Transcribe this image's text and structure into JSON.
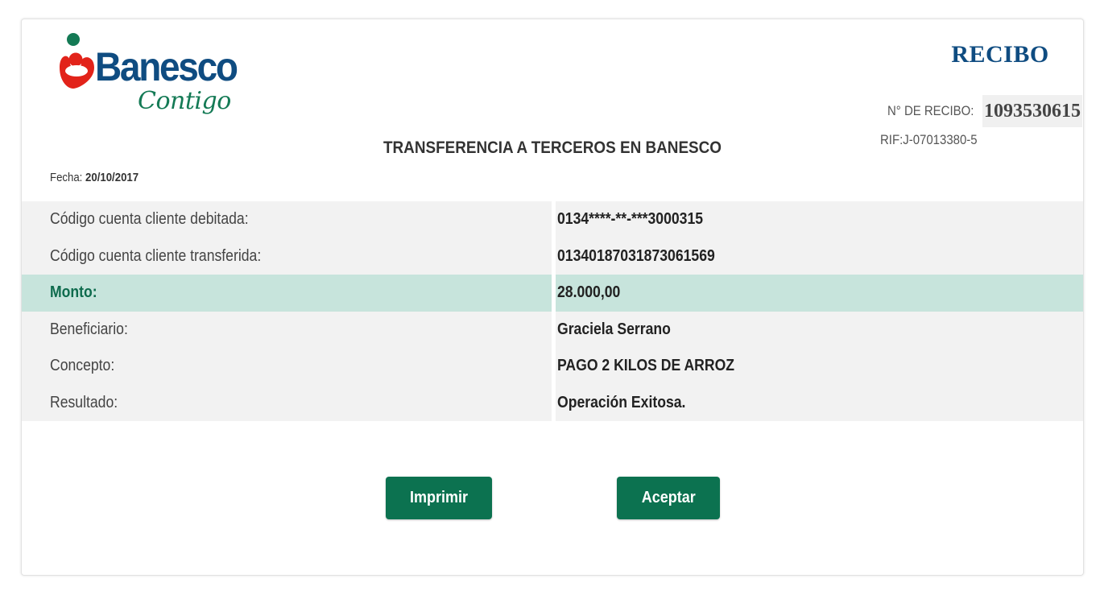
{
  "brand": {
    "name": "Banesco",
    "tagline": "Contigo",
    "colors": {
      "primary": "#0f4c81",
      "green": "#147a55",
      "red": "#e2231a"
    }
  },
  "receipt": {
    "title": "RECIBO",
    "number_label": "N° DE RECIBO:",
    "number": "1093530615",
    "rif": "RIF:J-07013380-5"
  },
  "operation": {
    "title": "TRANSFERENCIA A TERCEROS EN BANESCO",
    "date_label": "Fecha:",
    "date": "20/10/2017"
  },
  "details": [
    {
      "label": "Código cuenta cliente debitada:",
      "value": "0134****-**-***3000315"
    },
    {
      "label": "Código cuenta cliente transferida:",
      "value": "01340187031873061569"
    },
    {
      "label": "Monto:",
      "value": "28.000,00"
    },
    {
      "label": "Beneficiario:",
      "value": "Graciela Serrano"
    },
    {
      "label": "Concepto:",
      "value": "PAGO 2 KILOS DE ARROZ"
    },
    {
      "label": "Resultado:",
      "value": "Operación Exitosa."
    }
  ],
  "buttons": {
    "print": "Imprimir",
    "accept": "Aceptar"
  },
  "theme": {
    "button_bg": "#0c7250",
    "row_bg": "#f2f2f2",
    "highlight_bg": "#c7e4dc"
  }
}
